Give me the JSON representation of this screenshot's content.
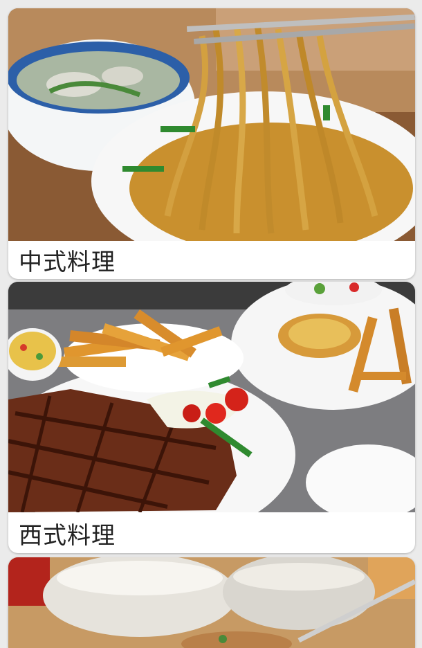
{
  "feed": {
    "cards": [
      {
        "label": "中式料理"
      },
      {
        "label": "西式料理"
      },
      {
        "label": ""
      }
    ]
  }
}
